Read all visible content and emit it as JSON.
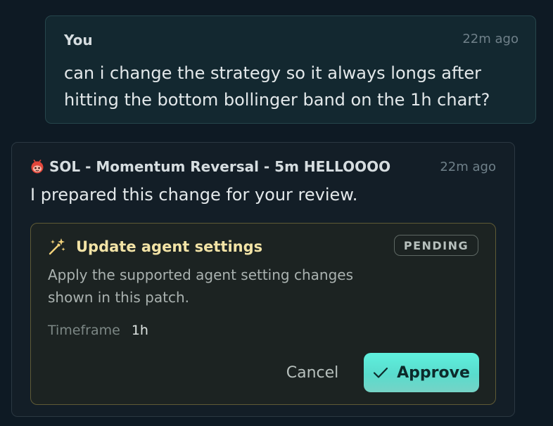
{
  "user_message": {
    "author": "You",
    "time": "22m ago",
    "text": "can i change the strategy so it always longs after hitting the bottom bollinger band on the 1h chart?"
  },
  "agent_message": {
    "author": "SOL - Momentum Reversal - 5m HELLOOOO",
    "author_icon": "red-bot-icon",
    "time": "22m ago",
    "text": "I prepared this change for your review."
  },
  "change_card": {
    "icon": "magic-wand-icon",
    "title": "Update agent settings",
    "status": "PENDING",
    "description": "Apply the supported agent setting changes shown in this patch.",
    "setting_label": "Timeframe",
    "setting_value": "1h",
    "cancel_label": "Cancel",
    "approve_label": "Approve"
  },
  "colors": {
    "background": "#0e1a24",
    "accent": "#5ff0de",
    "card_title": "#f2e3a6"
  }
}
